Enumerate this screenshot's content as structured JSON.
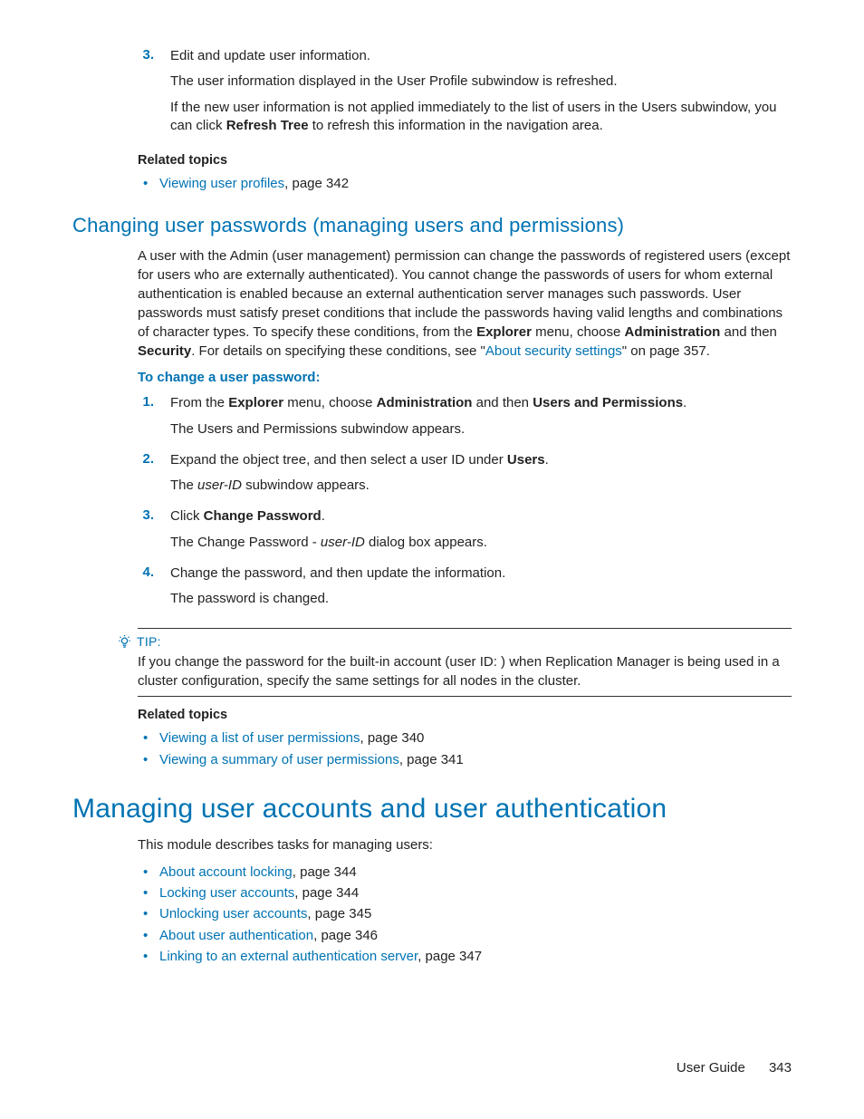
{
  "top": {
    "step3_num": "3.",
    "step3_text": "Edit and update user information.",
    "step3_p1": "The user information displayed in the User Profile subwindow is refreshed.",
    "step3_p2a": "If the new user information is not applied immediately to the list of users in the Users subwindow, you can click ",
    "step3_p2_bold": "Refresh Tree",
    "step3_p2b": " to refresh this information in the navigation area.",
    "related_title": "Related topics",
    "related_link": "Viewing user profiles",
    "related_tail": ", page 342"
  },
  "section1": {
    "heading": "Changing user passwords (managing users and permissions)",
    "para_a": "A user with the Admin (user management) permission can change the passwords of registered users (except for users who are externally authenticated). You cannot change the passwords of users for whom external authentication is enabled because an external authentication server manages such passwords. User passwords must satisfy preset conditions that include the passwords having valid lengths and combinations of character types. To specify these conditions, from the ",
    "para_b_bold1": "Explorer",
    "para_c": " menu, choose ",
    "para_d_bold2": "Administration",
    "para_e": " and then ",
    "para_f_bold3": "Security",
    "para_g": ". For details on specifying these conditions, see \"",
    "para_link": "About security settings",
    "para_h": "\" on page 357.",
    "proc_title": "To change a user password:",
    "steps": [
      {
        "num": "1.",
        "l1a": "From the ",
        "l1b": "Explorer",
        "l1c": " menu, choose ",
        "l1d": "Administration",
        "l1e": " and then ",
        "l1f": "Users and Permissions",
        "l1g": ".",
        "p2": "The Users and Permissions subwindow appears."
      },
      {
        "num": "2.",
        "l1a": "Expand the object tree, and then select a user ID under ",
        "l1b": "Users",
        "l1c": ".",
        "p2a": "The ",
        "p2_ital": "user-ID",
        "p2b": " subwindow appears."
      },
      {
        "num": "3.",
        "l1a": "Click ",
        "l1b": "Change Password",
        "l1c": ".",
        "p2a": "The Change Password - ",
        "p2_ital": "user-ID",
        "p2b": " dialog box appears."
      },
      {
        "num": "4.",
        "l1a": "Change the password, and then update the information.",
        "p2": "The password is changed."
      }
    ],
    "tip": {
      "label": "TIP:",
      "body": "If you change the password for the built-in account (user ID:              ) when Replication Manager is being used in a cluster configuration, specify the same settings for all nodes in the cluster."
    },
    "related_title": "Related topics",
    "related": [
      {
        "link": "Viewing a list of user permissions",
        "tail": ", page 340"
      },
      {
        "link": "Viewing a summary of user permissions",
        "tail": ", page 341"
      }
    ]
  },
  "section2": {
    "heading": "Managing user accounts and user authentication",
    "intro": "This module describes tasks for managing users:",
    "items": [
      {
        "link": "About account locking",
        "tail": ", page 344"
      },
      {
        "link": "Locking user accounts",
        "tail": ", page 344"
      },
      {
        "link": "Unlocking user accounts",
        "tail": ", page 345"
      },
      {
        "link": "About user authentication",
        "tail": ", page 346"
      },
      {
        "link": "Linking to an external authentication server",
        "tail": ", page 347"
      }
    ]
  },
  "footer": {
    "label": "User Guide",
    "page": "343"
  }
}
